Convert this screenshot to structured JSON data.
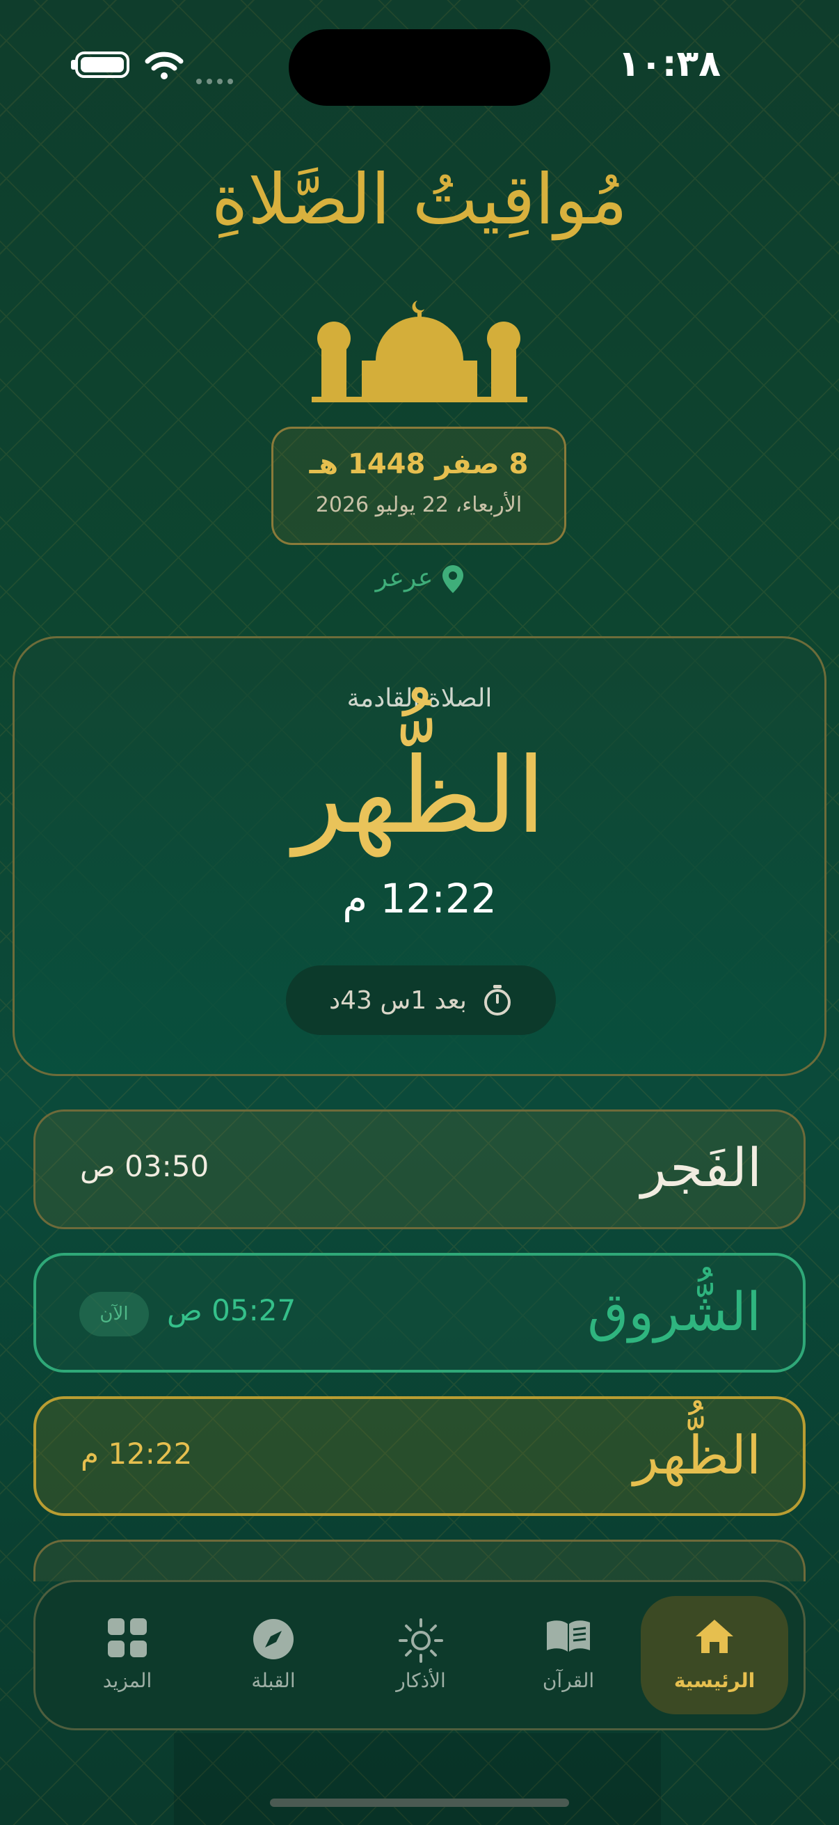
{
  "status_bar": {
    "time": "١٠:٣٨"
  },
  "header": {
    "title": "مُواقِيتُ الصَّلاةِ"
  },
  "date": {
    "hijri": "8 صفر 1448 هـ",
    "gregorian": "الأربعاء، 22 يوليو 2026"
  },
  "location": {
    "city": "عرعر"
  },
  "next_prayer": {
    "label": "الصلاة القادمة",
    "name": "الظُّهر",
    "time": "12:22 م",
    "countdown": "بعد 1س 43د"
  },
  "prayers": [
    {
      "name": "الفَجر",
      "time": "03:50 ص"
    },
    {
      "name": "الشُّروق",
      "time": "05:27 ص",
      "badge": "الآن"
    },
    {
      "name": "الظُّهر",
      "time": "12:22 م"
    }
  ],
  "tabs": [
    {
      "label": "الرئيسية",
      "icon": "home-icon",
      "active": true
    },
    {
      "label": "القرآن",
      "icon": "book-icon"
    },
    {
      "label": "الأذكار",
      "icon": "sun-icon"
    },
    {
      "label": "القبلة",
      "icon": "compass-icon"
    },
    {
      "label": "المزيد",
      "icon": "grid-icon"
    }
  ],
  "colors": {
    "gold": "#e6bf4f",
    "green_accent": "#2fb57f",
    "background": "#0d4530"
  }
}
